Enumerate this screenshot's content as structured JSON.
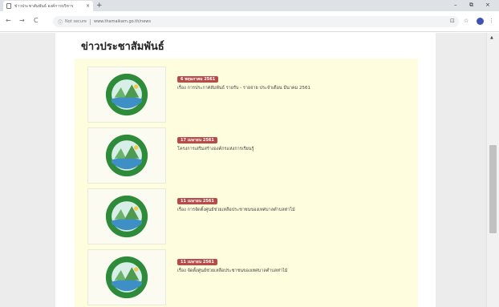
{
  "browser": {
    "tab_title": "ข่าวประชาสัมพันธ์ องค์การบริหาร",
    "tab_close": "×",
    "new_tab": "+",
    "minimize": "–",
    "restore": "⧉",
    "close": "×",
    "back": "←",
    "forward": "→",
    "reload": "C",
    "info_icon": "ⓘ",
    "security_label": "Not secure",
    "url": "www.thamaikarn.go.th/news",
    "translate_icon": "⊡",
    "star_icon": "☆",
    "menu_icon": "⋮"
  },
  "page": {
    "section_title": "ข่าวประชาสัมพันธ์",
    "news_items": [
      {
        "date": "6 พฤษภาคม 2561",
        "title": "เรื่อง การประกาศสัมพันธ์ รายรับ - รายจ่าย ประจำเดือน มีนาคม 2561"
      },
      {
        "date": "17 เมษายน 2561",
        "title": "โครงการเสริมสร้างองค์กรแห่งการเรียนรู้"
      },
      {
        "date": "11 เมษายน 2561",
        "title": "เรื่อง การจัดตั้งศูนย์ช่วยเหลือประชาชนของเทศบาลตำบลท่าไม้"
      },
      {
        "date": "11 เมษายน 2561",
        "title": "เรื่อง จัดตั้งศูนย์ช่วยเหลือประชาชนของเทศบาลตำบลท่าไม้"
      }
    ]
  },
  "scrollbar": {
    "up_arrow": "▲"
  },
  "colors": {
    "page_bg": "#ececec",
    "news_panel_bg": "#fefede",
    "date_badge": "#b94a48",
    "logo_green": "#2e8b3a"
  }
}
